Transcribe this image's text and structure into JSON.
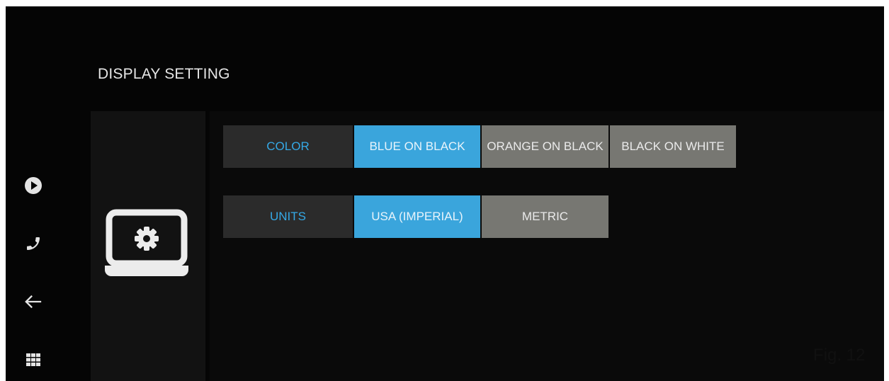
{
  "page": {
    "title": "DISPLAY SETTING",
    "figure_label": "Fig. 12"
  },
  "nav": {
    "items": [
      {
        "name": "play-icon"
      },
      {
        "name": "phone-icon"
      },
      {
        "name": "back-arrow-icon"
      },
      {
        "name": "apps-grid-icon"
      }
    ]
  },
  "side_panel": {
    "icon": "settings-monitor-icon"
  },
  "settings": {
    "color": {
      "label": "COLOR",
      "options": [
        "BLUE ON BLACK",
        "ORANGE ON BLACK",
        "BLACK ON WHITE"
      ],
      "selected": "BLUE ON BLACK"
    },
    "units": {
      "label": "UNITS",
      "options": [
        "USA (IMPERIAL)",
        "METRIC"
      ],
      "selected": "USA (IMPERIAL)"
    }
  },
  "colors": {
    "accent": "#3aa5dc",
    "label_text": "#35a9e6",
    "option_bg": "#777772",
    "row_label_bg": "#2b2b2b",
    "background": "#050505"
  }
}
